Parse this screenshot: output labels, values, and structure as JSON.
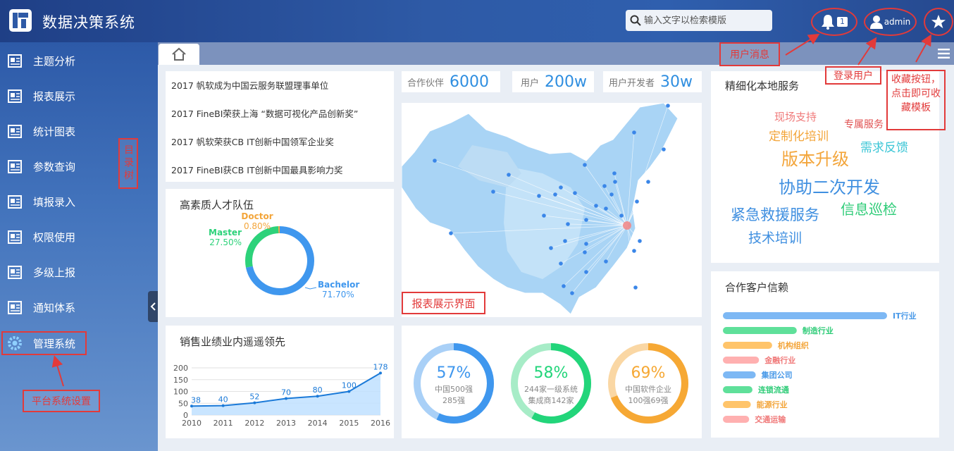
{
  "header": {
    "title": "数据决策系统",
    "search_placeholder": "输入文字以检索模版",
    "notification_count": "1",
    "user_name": "admin"
  },
  "sidebar": {
    "items": [
      {
        "label": "主题分析"
      },
      {
        "label": "报表展示"
      },
      {
        "label": "统计图表"
      },
      {
        "label": "参数查询"
      },
      {
        "label": "填报录入"
      },
      {
        "label": "权限使用"
      },
      {
        "label": "多级上报"
      },
      {
        "label": "通知体系"
      },
      {
        "label": "管理系统"
      }
    ]
  },
  "news": [
    "2017 帆软成为中国云服务联盟理事单位",
    "2017 FineBI荣获上海 “数据可视化产品创新奖”",
    "2017 帆软荣获CB IT创新中国领军企业奖",
    "2017 FineBI获CB IT创新中国最具影响力奖"
  ],
  "stats": [
    {
      "label": "合作伙伴",
      "value": "6000"
    },
    {
      "label": "用户",
      "value": "200w"
    },
    {
      "label": "用户开发者",
      "value": "30w"
    }
  ],
  "talent": {
    "title": "高素质人才队伍",
    "slices": [
      {
        "name": "Bachelor",
        "value": 71.7,
        "label": "71.70%",
        "color": "#3f97ee"
      },
      {
        "name": "Master",
        "value": 27.5,
        "label": "27.50%",
        "color": "#2dd27a"
      },
      {
        "name": "Doctor",
        "value": 0.8,
        "label": "0.80%",
        "color": "#f3a53a"
      }
    ]
  },
  "services": {
    "title": "精细化本地服务",
    "words": [
      "现场支持",
      "专属服务",
      "定制化培训",
      "需求反馈",
      "版本升级",
      "协助二次开发",
      "紧急救援服务",
      "信息巡检",
      "技术培训"
    ]
  },
  "sales": {
    "title": "销售业绩业内遥遥领先"
  },
  "rings": [
    {
      "pct": "57%",
      "value": 57,
      "line1": "中国500强",
      "line2": "285强",
      "color": "#3f97ee",
      "track": "#a9d0f7"
    },
    {
      "pct": "58%",
      "value": 58,
      "line1": "244家一级系统",
      "line2": "集成商142家",
      "color": "#22d57a",
      "track": "#a7ecc7"
    },
    {
      "pct": "69%",
      "value": 69,
      "line1": "中国软件企业",
      "line2": "100强69强",
      "color": "#f6a834",
      "track": "#fad7a4"
    }
  ],
  "clients": {
    "title": "合作客户信赖",
    "items": [
      {
        "name": "IT行业",
        "value": 100,
        "color": "#7db8f4",
        "text": "#4a9ae8"
      },
      {
        "name": "制造行业",
        "value": 45,
        "color": "#5fe09a",
        "text": "#2fcc78"
      },
      {
        "name": "机构组织",
        "value": 30,
        "color": "#ffc46a",
        "text": "#f3a53a"
      },
      {
        "name": "金融行业",
        "value": 22,
        "color": "#ffb0b0",
        "text": "#f07a7a"
      },
      {
        "name": "集团公司",
        "value": 20,
        "color": "#7db8f4",
        "text": "#4a9ae8"
      },
      {
        "name": "连锁流通",
        "value": 18,
        "color": "#5fe09a",
        "text": "#2fcc78"
      },
      {
        "name": "能源行业",
        "value": 17,
        "color": "#ffc46a",
        "text": "#f3a53a"
      },
      {
        "name": "交通运输",
        "value": 16,
        "color": "#ffb0b0",
        "text": "#f07a7a"
      }
    ]
  },
  "annotations": {
    "user_message": "用户消息",
    "login_user": "登录用户",
    "favorite": "收藏按钮，点击即可收藏模板",
    "directory_tree": "目录树",
    "report_view": "报表展示界面",
    "platform_settings": "平台系统设置"
  },
  "chart_data": {
    "type": "area",
    "x": [
      "2010",
      "2011",
      "2012",
      "2013",
      "2014",
      "2015",
      "2016"
    ],
    "values": [
      38,
      40,
      52,
      70,
      80,
      100,
      178
    ],
    "ylim": [
      0,
      200
    ],
    "yticks": [
      "0",
      "50",
      "100",
      "150",
      "200"
    ],
    "grid": true,
    "color": "#1b7ad8"
  }
}
